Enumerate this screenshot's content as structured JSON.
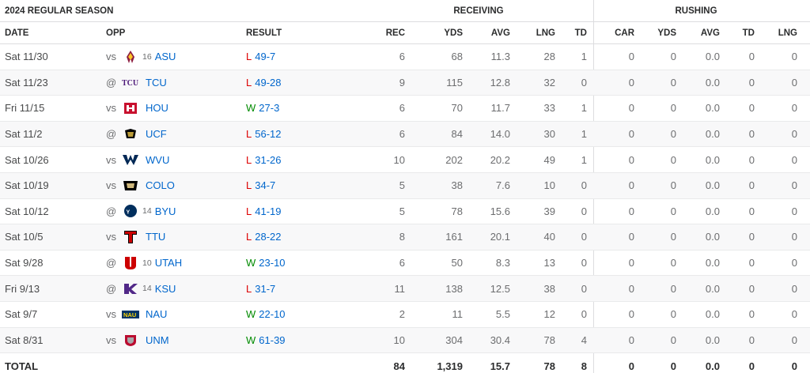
{
  "section_title": "2024 REGULAR SEASON",
  "group_headers": {
    "receiving": "RECEIVING",
    "rushing": "RUSHING"
  },
  "columns": {
    "date": "DATE",
    "opp": "OPP",
    "result": "RESULT",
    "rec": "REC",
    "rec_yds": "YDS",
    "rec_avg": "AVG",
    "rec_lng": "LNG",
    "rec_td": "TD",
    "car": "CAR",
    "rush_yds": "YDS",
    "rush_avg": "AVG",
    "rush_td": "TD",
    "rush_lng": "LNG"
  },
  "games": [
    {
      "date": "Sat 11/30",
      "ha": "vs",
      "rank": "16",
      "team": "ASU",
      "logo": "asu-logo",
      "wl": "L",
      "score": "49-7",
      "rec": "6",
      "yds": "68",
      "avg": "11.3",
      "lng": "28",
      "td": "1",
      "car": "0",
      "ryds": "0",
      "ravg": "0.0",
      "rtd": "0",
      "rlng": "0"
    },
    {
      "date": "Sat 11/23",
      "ha": "@",
      "rank": "",
      "team": "TCU",
      "logo": "tcu-logo",
      "wl": "L",
      "score": "49-28",
      "rec": "9",
      "yds": "115",
      "avg": "12.8",
      "lng": "32",
      "td": "0",
      "car": "0",
      "ryds": "0",
      "ravg": "0.0",
      "rtd": "0",
      "rlng": "0"
    },
    {
      "date": "Fri 11/15",
      "ha": "vs",
      "rank": "",
      "team": "HOU",
      "logo": "hou-logo",
      "wl": "W",
      "score": "27-3",
      "rec": "6",
      "yds": "70",
      "avg": "11.7",
      "lng": "33",
      "td": "1",
      "car": "0",
      "ryds": "0",
      "ravg": "0.0",
      "rtd": "0",
      "rlng": "0"
    },
    {
      "date": "Sat 11/2",
      "ha": "@",
      "rank": "",
      "team": "UCF",
      "logo": "ucf-logo",
      "wl": "L",
      "score": "56-12",
      "rec": "6",
      "yds": "84",
      "avg": "14.0",
      "lng": "30",
      "td": "1",
      "car": "0",
      "ryds": "0",
      "ravg": "0.0",
      "rtd": "0",
      "rlng": "0"
    },
    {
      "date": "Sat 10/26",
      "ha": "vs",
      "rank": "",
      "team": "WVU",
      "logo": "wvu-logo",
      "wl": "L",
      "score": "31-26",
      "rec": "10",
      "yds": "202",
      "avg": "20.2",
      "lng": "49",
      "td": "1",
      "car": "0",
      "ryds": "0",
      "ravg": "0.0",
      "rtd": "0",
      "rlng": "0"
    },
    {
      "date": "Sat 10/19",
      "ha": "vs",
      "rank": "",
      "team": "COLO",
      "logo": "colo-logo",
      "wl": "L",
      "score": "34-7",
      "rec": "5",
      "yds": "38",
      "avg": "7.6",
      "lng": "10",
      "td": "0",
      "car": "0",
      "ryds": "0",
      "ravg": "0.0",
      "rtd": "0",
      "rlng": "0"
    },
    {
      "date": "Sat 10/12",
      "ha": "@",
      "rank": "14",
      "team": "BYU",
      "logo": "byu-logo",
      "wl": "L",
      "score": "41-19",
      "rec": "5",
      "yds": "78",
      "avg": "15.6",
      "lng": "39",
      "td": "0",
      "car": "0",
      "ryds": "0",
      "ravg": "0.0",
      "rtd": "0",
      "rlng": "0"
    },
    {
      "date": "Sat 10/5",
      "ha": "vs",
      "rank": "",
      "team": "TTU",
      "logo": "ttu-logo",
      "wl": "L",
      "score": "28-22",
      "rec": "8",
      "yds": "161",
      "avg": "20.1",
      "lng": "40",
      "td": "0",
      "car": "0",
      "ryds": "0",
      "ravg": "0.0",
      "rtd": "0",
      "rlng": "0"
    },
    {
      "date": "Sat 9/28",
      "ha": "@",
      "rank": "10",
      "team": "UTAH",
      "logo": "utah-logo",
      "wl": "W",
      "score": "23-10",
      "rec": "6",
      "yds": "50",
      "avg": "8.3",
      "lng": "13",
      "td": "0",
      "car": "0",
      "ryds": "0",
      "ravg": "0.0",
      "rtd": "0",
      "rlng": "0"
    },
    {
      "date": "Fri 9/13",
      "ha": "@",
      "rank": "14",
      "team": "KSU",
      "logo": "ksu-logo",
      "wl": "L",
      "score": "31-7",
      "rec": "11",
      "yds": "138",
      "avg": "12.5",
      "lng": "38",
      "td": "0",
      "car": "0",
      "ryds": "0",
      "ravg": "0.0",
      "rtd": "0",
      "rlng": "0"
    },
    {
      "date": "Sat 9/7",
      "ha": "vs",
      "rank": "",
      "team": "NAU",
      "logo": "nau-logo",
      "wl": "W",
      "score": "22-10",
      "rec": "2",
      "yds": "11",
      "avg": "5.5",
      "lng": "12",
      "td": "0",
      "car": "0",
      "ryds": "0",
      "ravg": "0.0",
      "rtd": "0",
      "rlng": "0"
    },
    {
      "date": "Sat 8/31",
      "ha": "vs",
      "rank": "",
      "team": "UNM",
      "logo": "unm-logo",
      "wl": "W",
      "score": "61-39",
      "rec": "10",
      "yds": "304",
      "avg": "30.4",
      "lng": "78",
      "td": "4",
      "car": "0",
      "ryds": "0",
      "ravg": "0.0",
      "rtd": "0",
      "rlng": "0"
    }
  ],
  "totals": {
    "label": "TOTAL",
    "rec": "84",
    "yds": "1,319",
    "avg": "15.7",
    "lng": "78",
    "td": "8",
    "car": "0",
    "ryds": "0",
    "ravg": "0.0",
    "rtd": "0",
    "rlng": "0"
  },
  "colors": {
    "link": "#0066cc",
    "loss": "#dd0000",
    "win": "#008a00",
    "alt_row": "#f8f8f9"
  }
}
